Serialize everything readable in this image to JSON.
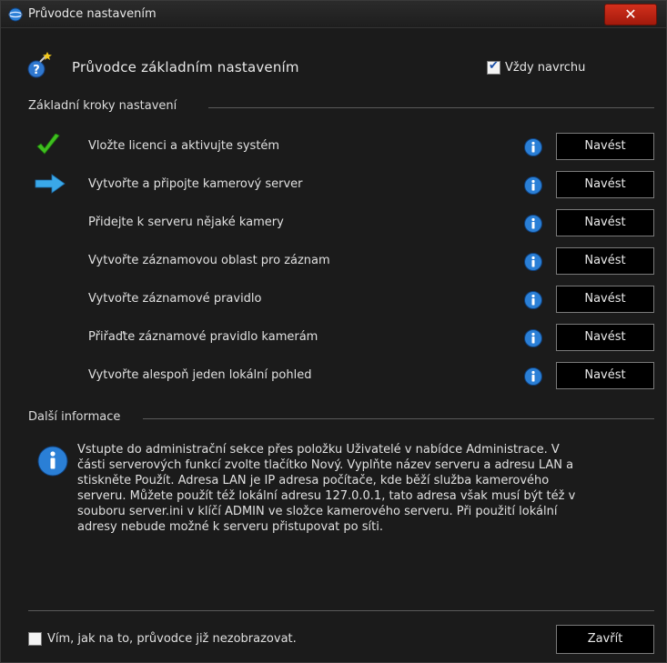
{
  "window": {
    "title": "Průvodce nastavením",
    "close_label": "✕"
  },
  "header": {
    "wizard_title": "Průvodce základním nastavením",
    "always_on_top_label": "Vždy navrchu",
    "always_on_top_checked": true
  },
  "basic_steps": {
    "section_title": "Základní kroky nastavení",
    "steps": [
      {
        "label": "Vložte licenci a aktivujte systém",
        "status": "done",
        "button": "Navést"
      },
      {
        "label": "Vytvořte a připojte kamerový server",
        "status": "current",
        "button": "Navést"
      },
      {
        "label": "Přidejte k serveru nějaké kamery",
        "status": "pending",
        "button": "Navést"
      },
      {
        "label": "Vytvořte záznamovou oblast pro záznam",
        "status": "pending",
        "button": "Navést"
      },
      {
        "label": "Vytvořte záznamové pravidlo",
        "status": "pending",
        "button": "Navést"
      },
      {
        "label": "Přiřaďte záznamové pravidlo kamerám",
        "status": "pending",
        "button": "Navést"
      },
      {
        "label": "Vytvořte alespoň jeden lokální pohled",
        "status": "pending",
        "button": "Navést"
      }
    ]
  },
  "more_info": {
    "section_title": "Další informace",
    "lines": [
      "Vstupte do administrační sekce přes položku Uživatelé v nabídce Administrace. V",
      "části serverových funkcí zvolte tlačítko Nový. Vyplňte název serveru a adresu LAN a",
      "stiskněte Použít. Adresa LAN je IP adresa počítače, kde běží služba kamerového",
      "serveru. Můžete použít též lokální adresu 127.0.0.1, tato adresa však musí být též v",
      "souboru server.ini v klíčí ADMIN ve složce kamerového serveru. Při použití lokální",
      "adresy nebude možné k serveru přistupovat po síti."
    ]
  },
  "footer": {
    "dont_show_label": "Vím, jak na to, průvodce již nezobrazovat.",
    "dont_show_checked": false,
    "close_button": "Zavřít"
  },
  "icons": {
    "title": "globe-icon",
    "wizard": "magic-wand-help-icon",
    "done": "green-checkmark-icon",
    "current": "blue-arrow-icon",
    "info": "info-icon"
  },
  "colors": {
    "background": "#1b1b1b",
    "close_button": "#c4261a",
    "check_green": "#3fbf1f",
    "arrow_blue": "#3aa8e8",
    "info_blue": "#2a7fd6"
  }
}
